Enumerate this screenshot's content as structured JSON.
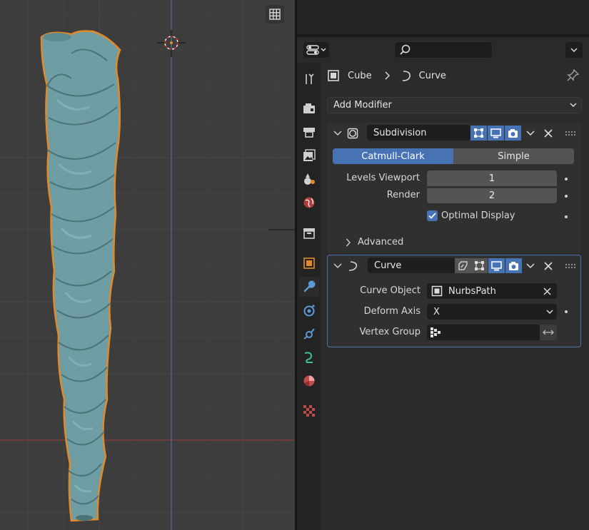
{
  "viewport": {
    "gizmo_icon": "grid-view-icon",
    "colors": {
      "background": "#3d3d3d",
      "grid": "#4a4a4a",
      "x_axis": "#9a3a3a",
      "y_axis": "#4a6fa0",
      "mesh": "#6e9ea3",
      "selection": "#e08a2b"
    }
  },
  "properties": {
    "search_placeholder": "",
    "breadcrumb": {
      "object": "Cube",
      "data": "Curve"
    },
    "add_modifier_label": "Add Modifier",
    "tabs": [
      "tool-icon",
      "render-icon",
      "output-icon",
      "view-layer-icon",
      "scene-icon",
      "world-icon",
      "collection-icon",
      "object-icon",
      "modifier-icon",
      "particles-icon",
      "physics-icon",
      "constraints-icon",
      "data-icon",
      "material-icon",
      "texture-icon"
    ],
    "active_tab": "modifier-icon"
  },
  "modifiers": {
    "subdivision": {
      "name": "Subdivision",
      "mode_options": [
        "Catmull-Clark",
        "Simple"
      ],
      "mode_selected": "Catmull-Clark",
      "levels_viewport_label": "Levels Viewport",
      "levels_viewport": "1",
      "render_label": "Render",
      "render": "2",
      "optimal_display_label": "Optimal Display",
      "optimal_display": true,
      "advanced_label": "Advanced"
    },
    "curve": {
      "name": "Curve",
      "curve_object_label": "Curve Object",
      "curve_object": "NurbsPath",
      "deform_axis_label": "Deform Axis",
      "deform_axis": "X",
      "vertex_group_label": "Vertex Group",
      "vertex_group": ""
    }
  },
  "accent": "#4772b3"
}
